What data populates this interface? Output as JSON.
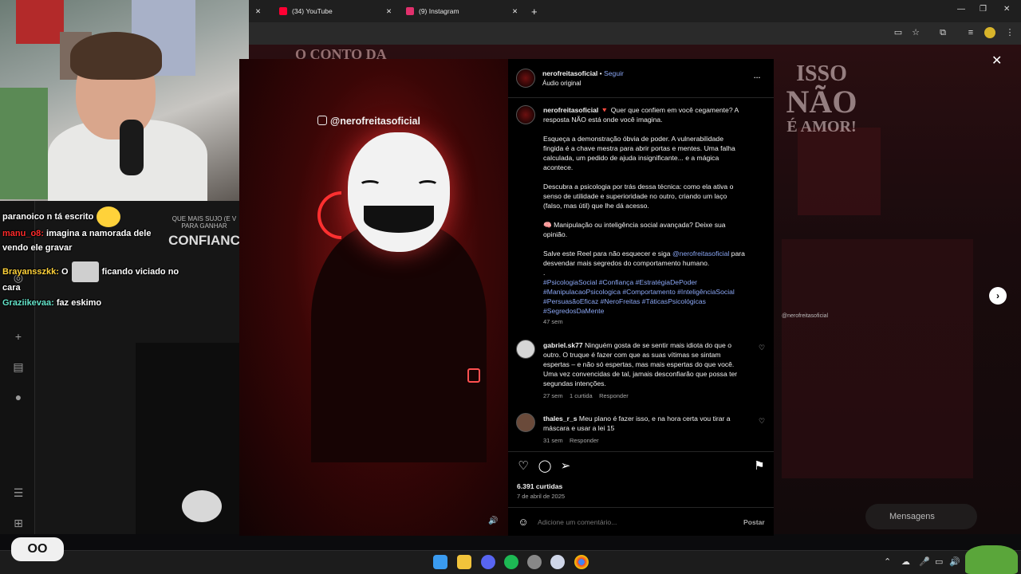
{
  "browser": {
    "tabs": [
      {
        "label": "(34) YouTube",
        "color": "#ff0033"
      },
      {
        "label": "(9) Instagram",
        "color": "#e1306c"
      }
    ],
    "new_tab": "+",
    "close_glyph": "✕"
  },
  "chat": {
    "lines": [
      {
        "user": "",
        "message": "paranoico n tá escrito",
        "user_color": ""
      },
      {
        "user": "manu_o8:",
        "message": "imagina a namorada dele",
        "user_color": "#ff2a2a"
      },
      {
        "user": "",
        "message": "vendo ele gravar",
        "user_color": ""
      },
      {
        "user": "Brayansszkk:",
        "message_before": "O",
        "message_after": "ficando viciado no",
        "user_color": "#ffd23a"
      },
      {
        "user": "",
        "message": "cara",
        "user_color": ""
      },
      {
        "user": "Graziikevaa:",
        "message": "faz eskimo",
        "user_color": "#64e3c9"
      }
    ]
  },
  "reel": {
    "background_title": "O CONTO DA",
    "watermark": "@nerofreitasoficial",
    "left_bg_lines": [
      "QUE MAIS SUJO (E V",
      "PARA GANHAR",
      "CONFIANC"
    ]
  },
  "post": {
    "username": "nerofreitasoficial",
    "dot": "•",
    "follow": "Seguir",
    "audio": "Áudio original",
    "more": "···",
    "caption_user": "nerofreitasoficial",
    "caption_lines": [
      "Quer que confiem em você cegamente? A",
      "resposta NÃO está onde você imagina."
    ],
    "paragraphs": [
      [
        "Esqueça a demonstração óbvia de poder. A vulnerabilidade",
        "fingida é a chave mestra para abrir portas e mentes. Uma falha",
        "calculada, um pedido de ajuda insignificante... e a mágica",
        "acontece."
      ],
      [
        "Descubra a psicologia por trás dessa técnica: como ela ativa o",
        "senso de utilidade e superioridade no outro, criando um laço",
        "(falso, mas útil) que lhe dá acesso."
      ],
      [
        "🧠 Manipulação ou inteligência social avançada? Deixe sua",
        "opinião."
      ]
    ],
    "cta_before": "Salve este Reel para não esquecer e siga",
    "cta_mention": "@nerofreitasoficial",
    "cta_after": "para",
    "cta_line2": "desvendar mais segredos do comportamento humano.",
    "dot_line": ".",
    "hashtags": [
      "#PsicologiaSocial #Confiança #EstratégiaDePoder",
      "#ManipulacaoPsicologica #Comportamento #InteligênciaSocial",
      "#PersuasãoEficaz #NeroFreitas #TáticasPsicológicas",
      "#SegredosDaMente"
    ],
    "caption_time": "47 sem",
    "comments": [
      {
        "user": "gabriel.sk77",
        "lines": [
          "Ninguém gosta de se sentir mais idiota do que o",
          "outro. O truque é fazer com que as suas vítimas se sintam",
          "espertas – e não só espertas, mas mais espertas do que você.",
          "Uma vez convencidas de tal, jamais desconfiarão que possa ter",
          "segundas intenções."
        ],
        "time": "27 sem",
        "likes": "1 curtida",
        "reply": "Responder"
      },
      {
        "user": "thales_r_s",
        "lines": [
          "Meu plano é fazer isso, e na hora certa vou tirar a",
          "máscara e usar a lei 15"
        ],
        "time": "31 sem",
        "reply": "Responder"
      }
    ],
    "likes": "6.391 curtidas",
    "date": "7 de abril de 2025",
    "comment_placeholder": "Adicione um comentário...",
    "post_button": "Postar"
  },
  "background_right": {
    "lines": [
      "ISSO",
      "NÃO",
      "É AMOR!"
    ],
    "watermark": "@nerofreitasoficial"
  },
  "messages_label": "Mensagens",
  "overlay_logo": "OO"
}
